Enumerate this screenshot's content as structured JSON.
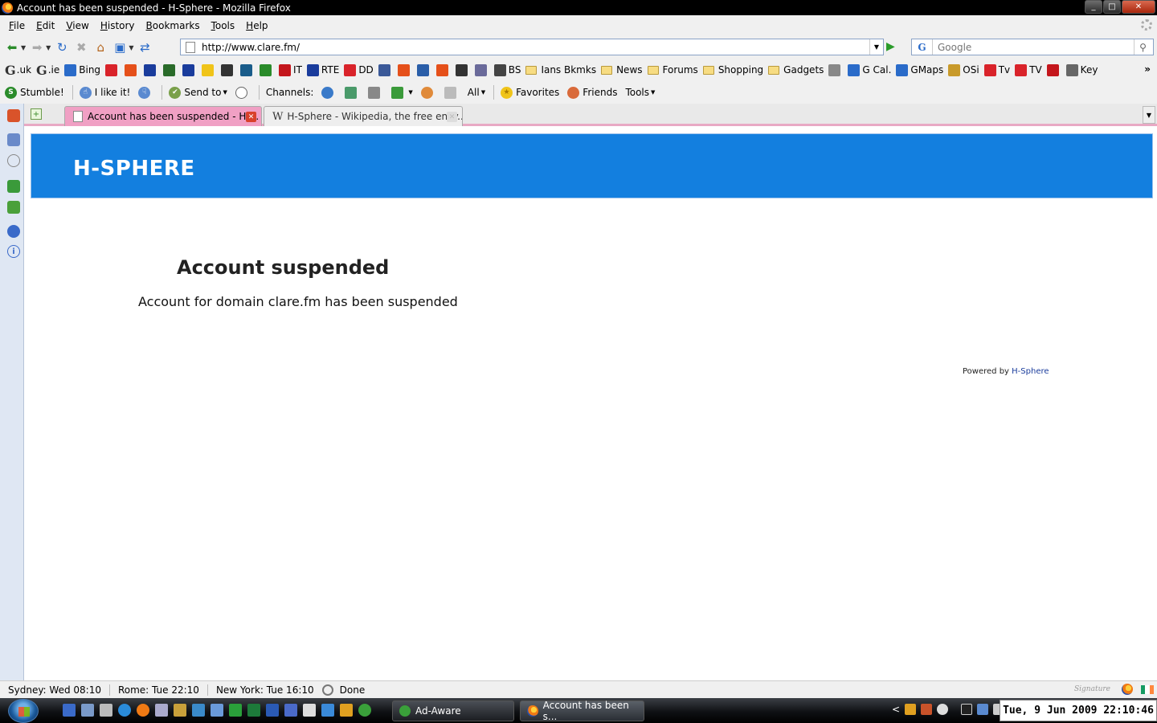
{
  "window": {
    "title": "Account has been suspended - H-Sphere - Mozilla Firefox",
    "controls": [
      "_",
      "□",
      "✕"
    ]
  },
  "menubar": {
    "items": [
      "File",
      "Edit",
      "View",
      "History",
      "Bookmarks",
      "Tools",
      "Help"
    ]
  },
  "navbar": {
    "url": "http://www.clare.fm/",
    "search_placeholder": "Google"
  },
  "bookmarks": {
    "items": [
      {
        "label": ".uk",
        "icon": "google-g"
      },
      {
        "label": ".ie",
        "icon": "google-g"
      },
      {
        "label": "Bing",
        "icon": "bing-icon",
        "color": "#2a6bc9"
      },
      {
        "label": "",
        "icon": "site-icon",
        "color": "#d9232a"
      },
      {
        "label": "",
        "icon": "ubuntu-icon",
        "color": "#e5501a"
      },
      {
        "label": "",
        "icon": "site-icon",
        "color": "#1a3c9c"
      },
      {
        "label": "",
        "icon": "site-icon",
        "color": "#2a6b2a"
      },
      {
        "label": "",
        "icon": "site-icon",
        "color": "#1a3c9c"
      },
      {
        "label": "",
        "icon": "site-icon",
        "color": "#f0c419"
      },
      {
        "label": "",
        "icon": "site-icon",
        "color": "#333333"
      },
      {
        "label": "",
        "icon": "site-icon",
        "color": "#1a5c8a"
      },
      {
        "label": "",
        "icon": "site-icon",
        "color": "#2a8b2a"
      },
      {
        "label": "IT",
        "icon": "site-icon",
        "color": "#c4161c"
      },
      {
        "label": "RTE",
        "icon": "site-icon",
        "color": "#1a3c9c"
      },
      {
        "label": "DD",
        "icon": "site-icon",
        "color": "#d9232a"
      },
      {
        "label": "",
        "icon": "facebook-icon",
        "color": "#3b5998"
      },
      {
        "label": "",
        "icon": "site-icon",
        "color": "#e5501a"
      },
      {
        "label": "",
        "icon": "site-icon",
        "color": "#2a5ea8"
      },
      {
        "label": "",
        "icon": "site-icon",
        "color": "#e5501a"
      },
      {
        "label": "",
        "icon": "site-icon",
        "color": "#333333"
      },
      {
        "label": "",
        "icon": "site-icon",
        "color": "#6a6a9a"
      },
      {
        "label": "BS",
        "icon": "site-icon",
        "color": "#444444"
      },
      {
        "label": "Ians Bkmks",
        "icon": "folder"
      },
      {
        "label": "News",
        "icon": "folder"
      },
      {
        "label": "Forums",
        "icon": "folder"
      },
      {
        "label": "Shopping",
        "icon": "folder"
      },
      {
        "label": "Gadgets",
        "icon": "folder"
      },
      {
        "label": "",
        "icon": "site-icon",
        "color": "#888888"
      },
      {
        "label": "G Cal.",
        "icon": "calendar-icon",
        "color": "#2a6bc9"
      },
      {
        "label": "GMaps",
        "icon": "maps-icon",
        "color": "#2a6bc9"
      },
      {
        "label": "OSi",
        "icon": "site-icon",
        "color": "#c89a2a"
      },
      {
        "label": "Tv",
        "icon": "site-icon",
        "color": "#d9232a"
      },
      {
        "label": "TV",
        "icon": "site-icon",
        "color": "#d9232a"
      },
      {
        "label": "",
        "icon": "youtube-icon",
        "color": "#c4161c"
      },
      {
        "label": "Key",
        "icon": "lock-icon",
        "color": "#666666"
      }
    ],
    "more": "»"
  },
  "stumblebar": {
    "stumble": "Stumble!",
    "ilike": "I like it!",
    "sendto": "Send to",
    "channels": "Channels:",
    "all": "All",
    "favorites": "Favorites",
    "friends": "Friends",
    "tools": "Tools"
  },
  "tabs": [
    {
      "title": "Account has been suspended - H-...",
      "active": true
    },
    {
      "title": "H-Sphere - Wikipedia, the free ency...",
      "active": false
    }
  ],
  "page": {
    "logo": "H-SPHERE",
    "banner_color": "#137fdf",
    "heading": "Account suspended",
    "message": "Account for domain clare.fm has been suspended",
    "powered_prefix": "Powered by",
    "powered_link": "H-Sphere"
  },
  "statusbar": {
    "clocks": [
      "Sydney: Wed 08:10",
      "Rome: Tue 22:10",
      "New York: Tue 16:10"
    ],
    "status": "Done"
  },
  "taskbar": {
    "buttons": [
      "Ad-Aware",
      "Account has been s..."
    ],
    "clock": "Tue, 9 Jun 2009  22:10:46"
  }
}
